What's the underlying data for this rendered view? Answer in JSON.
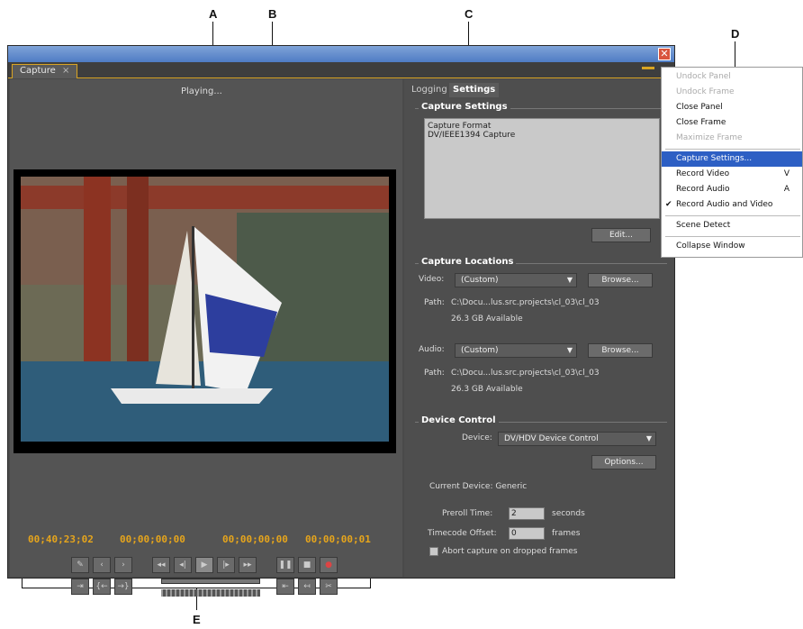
{
  "callouts": {
    "a": "A",
    "b": "B",
    "c": "C",
    "d": "D",
    "e": "E"
  },
  "window": {
    "tab_title": "Capture",
    "tab_close": "×",
    "close_glyph": "✕"
  },
  "monitor": {
    "status": "Playing...",
    "timecodes": {
      "current": "00;40;23;02",
      "in": "00;00;00;00",
      "out": "00;00;00;00",
      "duration": "00;00;00;01"
    }
  },
  "transport": {
    "row1": [
      "✎",
      "‹",
      "›",
      "◂◂",
      "◂|",
      "▶",
      "|▸",
      "▸▸",
      "❚❚",
      "■",
      "●"
    ],
    "row2": [
      "⇥",
      "{←",
      "→}",
      "⇤",
      "↤",
      "✂"
    ]
  },
  "right_panel": {
    "tabs": [
      "Logging",
      "Settings"
    ],
    "capture_settings": {
      "title": "Capture Settings",
      "format_label": "Capture Format",
      "format_value": "DV/IEEE1394 Capture",
      "edit": "Edit..."
    },
    "capture_locations": {
      "title": "Capture Locations",
      "video_label": "Video:",
      "video_select": "(Custom)",
      "browse": "Browse...",
      "path_label": "Path:",
      "video_path": "C:\\Docu...lus.src.projects\\cl_03\\cl_03",
      "video_avail": "26.3 GB Available",
      "audio_label": "Audio:",
      "audio_select": "(Custom)",
      "audio_path": "C:\\Docu...lus.src.projects\\cl_03\\cl_03",
      "audio_avail": "26.3 GB Available"
    },
    "device_control": {
      "title": "Device Control",
      "device_label": "Device:",
      "device_select": "DV/HDV Device Control",
      "options": "Options...",
      "current_device": "Current Device: Generic",
      "preroll_label": "Preroll Time:",
      "preroll_value": "2",
      "preroll_unit": "seconds",
      "offset_label": "Timecode Offset:",
      "offset_value": "0",
      "offset_unit": "frames",
      "abort_label": "Abort capture on dropped frames"
    }
  },
  "menu": {
    "items": [
      {
        "label": "Undock Panel",
        "disabled": true
      },
      {
        "label": "Undock Frame",
        "disabled": true
      },
      {
        "label": "Close Panel"
      },
      {
        "label": "Close Frame"
      },
      {
        "label": "Maximize Frame",
        "disabled": true
      },
      {
        "label": "Capture Settings...",
        "selected": true
      },
      {
        "label": "Record Video",
        "shortcut": "V"
      },
      {
        "label": "Record Audio",
        "shortcut": "A"
      },
      {
        "label": "Record Audio and Video",
        "checked": true
      },
      {
        "label": "Scene Detect"
      },
      {
        "label": "Collapse Window"
      }
    ]
  }
}
